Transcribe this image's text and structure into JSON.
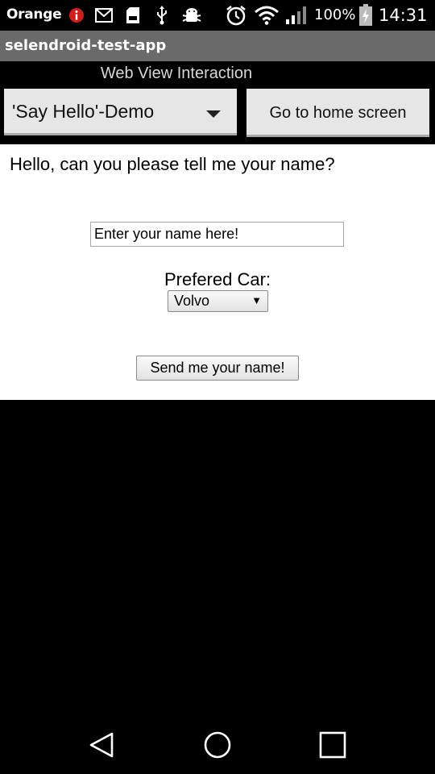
{
  "status_bar": {
    "carrier": "Orange",
    "battery_percent": "100%",
    "time": "14:31",
    "icons": [
      "alert-icon",
      "gmail-icon",
      "sd-card-icon",
      "usb-icon",
      "android-debug-icon",
      "alarm-icon",
      "wifi-icon",
      "signal-icon",
      "battery-charging-icon"
    ]
  },
  "title_bar": {
    "title": "selendroid-test-app"
  },
  "activity": {
    "label": "Web View Interaction",
    "spinner_value": "'Say Hello'-Demo",
    "home_button_label": "Go to home screen"
  },
  "webview": {
    "question": "Hello, can you please tell me your name?",
    "name_placeholder": "Enter your name here!",
    "car_label": "Prefered Car:",
    "car_selected": "Volvo",
    "send_button_label": "Send me your name!"
  },
  "nav_bar": {
    "icons": [
      "back-icon",
      "home-icon",
      "recents-icon"
    ]
  },
  "colors": {
    "title_bar_bg": "#6a6a6a",
    "button_bg": "#e6e6e6",
    "webview_bg": "#ffffff",
    "screen_bg": "#000000"
  }
}
